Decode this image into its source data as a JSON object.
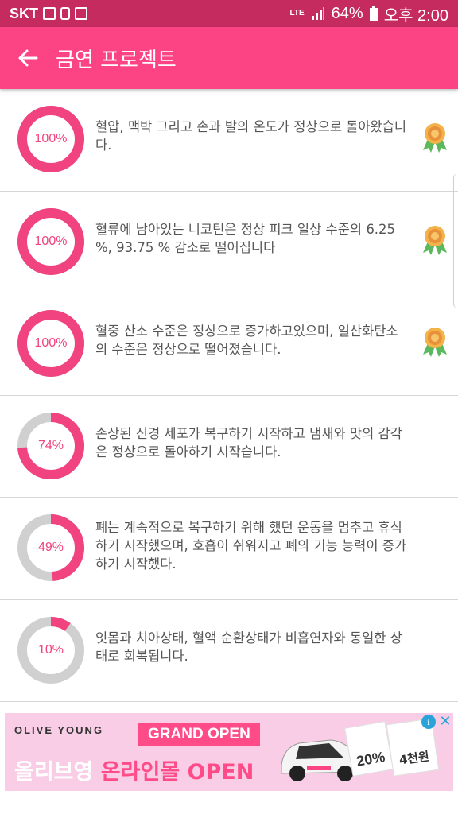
{
  "status": {
    "carrier": "SKT",
    "network": "LTE",
    "battery": "64%",
    "time": "오후 2:00"
  },
  "app_bar": {
    "back_icon": "arrow-left-icon",
    "title": "금연 프로젝트"
  },
  "items": [
    {
      "percent_label": "100%",
      "percent": 100,
      "text": "혈압, 맥박 그리고 손과 발의 온도가 정상으로 돌아왔습니다.",
      "medal": true
    },
    {
      "percent_label": "100%",
      "percent": 100,
      "text": "혈류에 남아있는 니코틴은 정상 피크 일상 수준의 6.25 %, 93.75 % 감소로 떨어집니다",
      "medal": true
    },
    {
      "percent_label": "100%",
      "percent": 100,
      "text": "혈중 산소 수준은 정상으로 증가하고있으며, 일산화탄소의 수준은 정상으로 떨어졌습니다.",
      "medal": true
    },
    {
      "percent_label": "74%",
      "percent": 74,
      "text": "손상된 신경 세포가 복구하기 시작하고 냄새와 맛의 감각은 정상으로 돌아하기 시작습니다.",
      "medal": false
    },
    {
      "percent_label": "49%",
      "percent": 49,
      "text": "폐는 계속적으로 복구하기 위해 했던 운동을 멈추고 휴식하기 시작했으며, 호흡이 쉬워지고 폐의 기능 능력이 증가하기 시작했다.",
      "medal": false
    },
    {
      "percent_label": "10%",
      "percent": 10,
      "text": "잇몸과 치아상태, 혈액 순환상태가 비흡연자와 동일한 상태로 회복됩니다.",
      "medal": false
    }
  ],
  "ad": {
    "brand": "OLIVE YOUNG",
    "badge": "GRAND OPEN",
    "headline_part1": "올리브영 ",
    "headline_part2": "온라인몰",
    "headline_part3": " OPEN",
    "coupon1": "20%",
    "coupon2": "4천원",
    "info_icon": "info-icon",
    "close_icon": "close-icon"
  },
  "colors": {
    "status_bar": "#c52b5f",
    "accent": "#fc4383",
    "ring_fill": "#f0437f",
    "ring_track": "#d0d0d0"
  }
}
